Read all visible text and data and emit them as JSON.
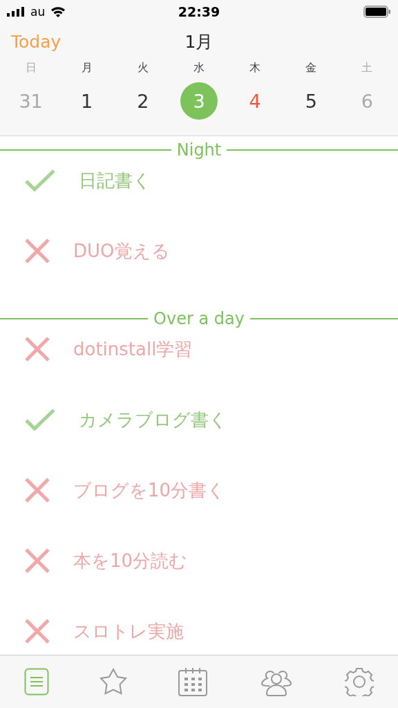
{
  "status_bar": {
    "carrier": "au",
    "time": "22:39"
  },
  "header": {
    "today_button": "Today",
    "month": "1月",
    "weekdays": [
      {
        "label": "日",
        "kind": "weekend"
      },
      {
        "label": "月",
        "kind": "weekday"
      },
      {
        "label": "火",
        "kind": "weekday"
      },
      {
        "label": "水",
        "kind": "weekday"
      },
      {
        "label": "木",
        "kind": "weekday"
      },
      {
        "label": "金",
        "kind": "weekday"
      },
      {
        "label": "土",
        "kind": "weekend"
      }
    ],
    "days": [
      {
        "label": "31",
        "kind": "muted",
        "selected": false
      },
      {
        "label": "1",
        "kind": "normal",
        "selected": false
      },
      {
        "label": "2",
        "kind": "normal",
        "selected": false
      },
      {
        "label": "3",
        "kind": "normal",
        "selected": true
      },
      {
        "label": "4",
        "kind": "today",
        "selected": false
      },
      {
        "label": "5",
        "kind": "normal",
        "selected": false
      },
      {
        "label": "6",
        "kind": "muted",
        "selected": false
      }
    ]
  },
  "sections": [
    {
      "title": "Night",
      "tasks": [
        {
          "label": "日記書く",
          "done": true
        },
        {
          "label": "DUO覚える",
          "done": false
        }
      ]
    },
    {
      "title": "Over a day",
      "tasks": [
        {
          "label": "dotinstall学習",
          "done": false
        },
        {
          "label": "カメラブログ書く",
          "done": true
        },
        {
          "label": "ブログを10分書く",
          "done": false
        },
        {
          "label": "本を10分読む",
          "done": false
        },
        {
          "label": "スロトレ実施",
          "done": false
        }
      ]
    }
  ],
  "tab_bar": [
    {
      "kind": "list",
      "selected": true
    },
    {
      "kind": "star",
      "selected": false
    },
    {
      "kind": "calendar",
      "selected": false
    },
    {
      "kind": "people",
      "selected": false
    },
    {
      "kind": "settings",
      "selected": false
    }
  ]
}
